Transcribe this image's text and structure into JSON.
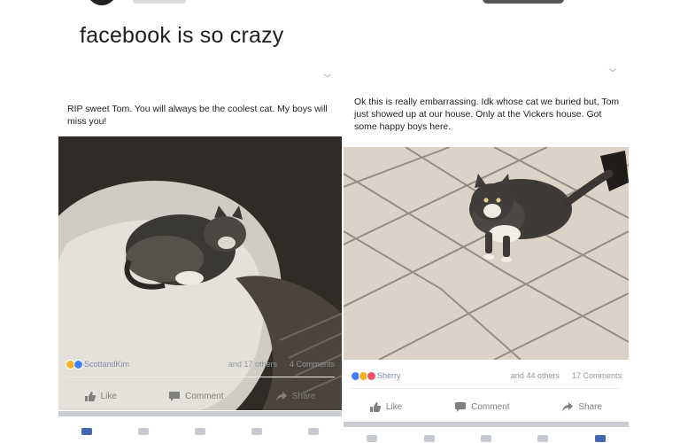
{
  "tweet": {
    "text": "facebook is so crazy"
  },
  "posts": [
    {
      "caption": "RIP sweet Tom.  You will always be the coolest cat.  My boys will miss you!",
      "reactions": [
        "haha",
        "like"
      ],
      "reactor": "ScottandKim",
      "others": "and 17 others",
      "comments": "4 Comments",
      "actions": {
        "like": "Like",
        "comment": "Comment",
        "share": "Share"
      }
    },
    {
      "caption": "Ok this is really embarrassing.  Idk whose cat we buried but, Tom just showed up at our house. Only at the Vickers house.  Got some happy boys here.",
      "reactions": [
        "like",
        "haha",
        "love"
      ],
      "reactor": "Sherry",
      "others": "and 44 others",
      "comments": "17 Comments",
      "actions": {
        "like": "Like",
        "comment": "Comment",
        "share": "Share"
      }
    }
  ],
  "colors": {
    "link": "#4267b2",
    "muted": "#90949c",
    "divider": "#e9ebee"
  }
}
